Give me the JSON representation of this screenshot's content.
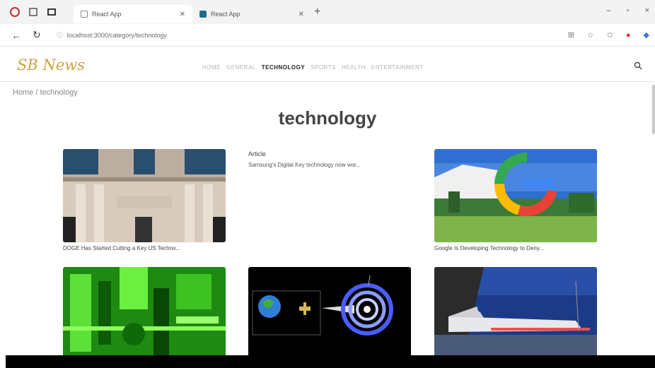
{
  "browser": {
    "tabs": [
      {
        "title": "React App",
        "active": true
      },
      {
        "title": "React App",
        "active": false
      }
    ],
    "url": "localhost:3000/category/technology",
    "new_tab": "+",
    "controls": {
      "minimize": "–",
      "maximize": "▫",
      "close": "×"
    }
  },
  "site": {
    "logo": "SB News",
    "nav": [
      "HOME",
      "GENERAL",
      "TECHNOLOGY",
      "SPORTS",
      "HEALTH",
      "ENTERTAINMENT"
    ],
    "active_nav": "TECHNOLOGY",
    "breadcrumb": "Home / technology",
    "page_title": "technology"
  },
  "articles": [
    {
      "caption": "DOGE Has Started Cutting a Key US Techno...",
      "image": "building-facade"
    },
    {
      "heading": "Article",
      "caption": "Samsung's Digital Key technology now wor...",
      "image": "none"
    },
    {
      "caption": "Google Is Developing Technology to Deny...",
      "image": "google-logo-sculpture"
    },
    {
      "caption": "",
      "image": "green-machinery"
    },
    {
      "caption": "",
      "image": "earth-spiral-galaxy"
    },
    {
      "caption": "",
      "image": "nasa-space-shuttle"
    }
  ],
  "colors": {
    "logo": "#c9a240",
    "accent_active": "#222222"
  }
}
